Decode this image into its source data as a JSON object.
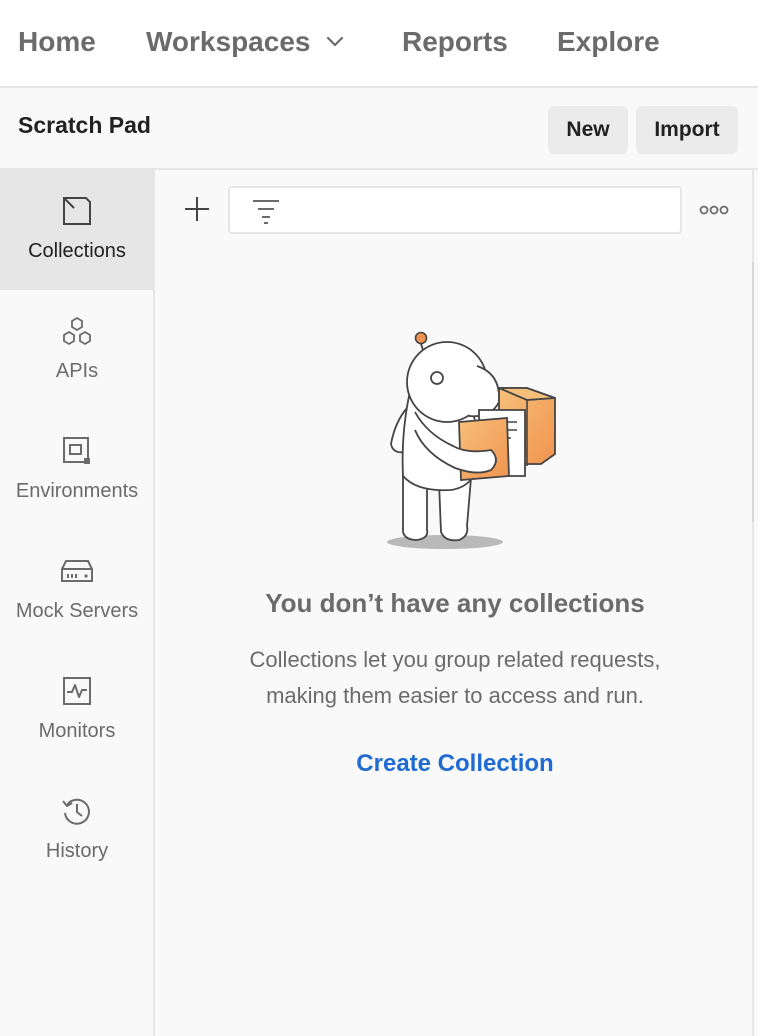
{
  "nav": {
    "home": "Home",
    "workspaces": "Workspaces",
    "reports": "Reports",
    "explore": "Explore"
  },
  "header": {
    "title": "Scratch Pad",
    "new_label": "New",
    "import_label": "Import"
  },
  "sidebar": {
    "items": [
      {
        "label": "Collections",
        "icon": "collections-icon",
        "active": true
      },
      {
        "label": "APIs",
        "icon": "apis-icon",
        "active": false
      },
      {
        "label": "Environments",
        "icon": "environments-icon",
        "active": false
      },
      {
        "label": "Mock Servers",
        "icon": "mock-servers-icon",
        "active": false
      },
      {
        "label": "Monitors",
        "icon": "monitors-icon",
        "active": false
      },
      {
        "label": "History",
        "icon": "history-icon",
        "active": false
      }
    ]
  },
  "toolbar": {
    "search_value": "",
    "search_placeholder": ""
  },
  "empty_state": {
    "title": "You don’t have any collections",
    "description_line1": "Collections let you group related requests,",
    "description_line2": "making them easier to access and run.",
    "action": "Create Collection"
  },
  "colors": {
    "accent_link": "#1f6bd1",
    "illustration_orange": "#f0944f",
    "illustration_gradient_light": "#f7c07a"
  }
}
